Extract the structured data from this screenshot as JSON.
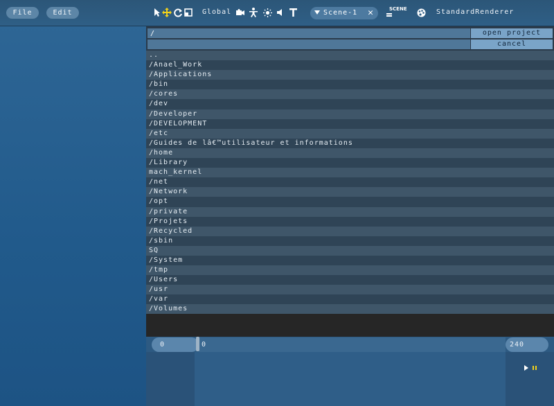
{
  "menu": {
    "file": "File",
    "edit": "Edit"
  },
  "toolbar": {
    "space_label": "Global",
    "scene_tab": "Scene-1",
    "scene_close": "✕",
    "scene_icon_label": "SCENE",
    "renderer": "StandardRenderer",
    "accent_color": "#f2d21a"
  },
  "dialog": {
    "path_value": "/",
    "filter_value": "",
    "open_label": "open project",
    "cancel_label": "cancel",
    "entries": [
      "..",
      "/Anael_Work",
      "/Applications",
      "/bin",
      "/cores",
      "/dev",
      "/Developer",
      "/DEVELOPMENT",
      "/etc",
      "/Guides de lâ€™utilisateur et informations",
      "/home",
      "/Library",
      "mach_kernel",
      "/net",
      "/Network",
      "/opt",
      "/private",
      "/Projets",
      "/Recycled",
      "/sbin",
      "SQ",
      "/System",
      "/tmp",
      "/Users",
      "/usr",
      "/var",
      "/Volumes"
    ]
  },
  "timeline": {
    "start": "0",
    "current": "0",
    "end": "240"
  }
}
